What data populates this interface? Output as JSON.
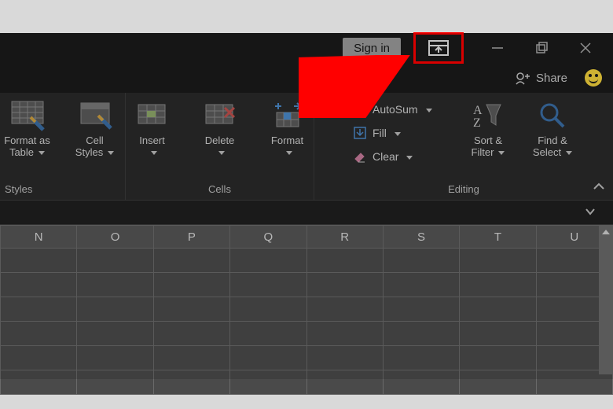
{
  "titlebar": {
    "sign_in": "Sign in"
  },
  "quick": {
    "share": "Share"
  },
  "ribbon": {
    "groups": {
      "styles_label": "Styles",
      "cells_label": "Cells",
      "editing_label": "Editing"
    },
    "styles": {
      "format_as_table_l1": "Format as",
      "format_as_table_l2": "Table",
      "cell_styles_l1": "Cell",
      "cell_styles_l2": "Styles"
    },
    "cells": {
      "insert": "Insert",
      "delete": "Delete",
      "format": "Format"
    },
    "editing": {
      "autosum": "AutoSum",
      "fill": "Fill",
      "clear": "Clear",
      "sort_filter_l1": "Sort &",
      "sort_filter_l2": "Filter",
      "find_select_l1": "Find &",
      "find_select_l2": "Select"
    }
  },
  "grid": {
    "columns": [
      "N",
      "O",
      "P",
      "Q",
      "R",
      "S",
      "T",
      "U"
    ]
  }
}
